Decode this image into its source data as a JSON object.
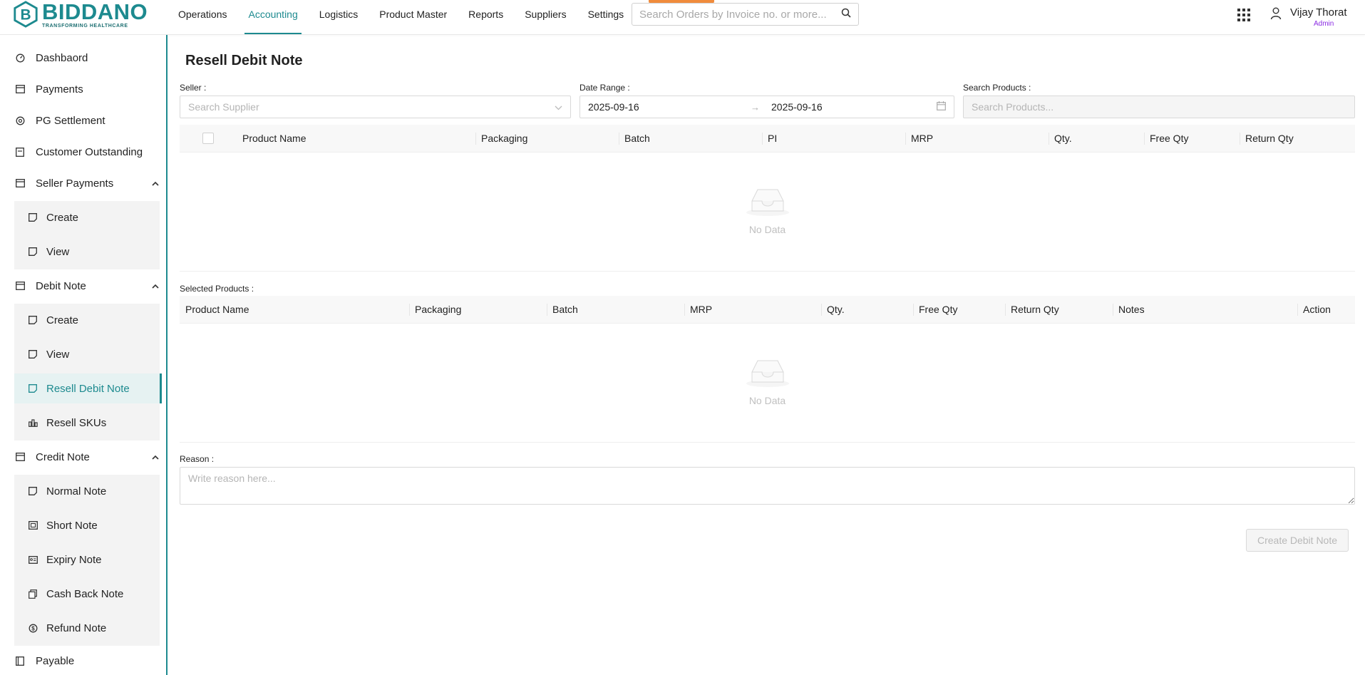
{
  "brand": {
    "name": "BIDDANO",
    "tagline": "TRANSFORMING HEALTHCARE",
    "color": "#1d8a8f"
  },
  "topnav": [
    {
      "label": "Operations",
      "active": false
    },
    {
      "label": "Accounting",
      "active": true
    },
    {
      "label": "Logistics",
      "active": false
    },
    {
      "label": "Product Master",
      "active": false
    },
    {
      "label": "Reports",
      "active": false
    },
    {
      "label": "Suppliers",
      "active": false
    },
    {
      "label": "Settings",
      "active": false
    }
  ],
  "header_search": {
    "placeholder": "Search Orders by Invoice no. or more..."
  },
  "user": {
    "name": "Vijay Thorat",
    "role": "Admin"
  },
  "sidebar": {
    "dashboard": "Dashbaord",
    "payments": "Payments",
    "pg_settlement": "PG Settlement",
    "customer_outstanding": "Customer Outstanding",
    "seller_payments": {
      "label": "Seller Payments",
      "create": "Create",
      "view": "View"
    },
    "debit_note": {
      "label": "Debit Note",
      "create": "Create",
      "view": "View",
      "resell_debit_note": "Resell Debit Note",
      "resell_skus": "Resell SKUs"
    },
    "credit_note": {
      "label": "Credit Note",
      "normal": "Normal Note",
      "short": "Short Note",
      "expiry": "Expiry Note",
      "cashback": "Cash Back Note",
      "refund": "Refund Note"
    },
    "payable": "Payable"
  },
  "page": {
    "title": "Resell Debit Note",
    "seller_label": "Seller :",
    "seller_placeholder": "Search Supplier",
    "date_label": "Date Range :",
    "date_from": "2025-09-16",
    "date_to": "2025-09-16",
    "date_separator": "→",
    "products_label": "Search Products :",
    "products_placeholder": "Search Products...",
    "products_table": {
      "columns": [
        "Product Name",
        "Packaging",
        "Batch",
        "PI",
        "MRP",
        "Qty.",
        "Free Qty",
        "Return Qty"
      ],
      "empty": "No Data"
    },
    "selected_label": "Selected Products :",
    "selected_table": {
      "columns": [
        "Product Name",
        "Packaging",
        "Batch",
        "MRP",
        "Qty.",
        "Free Qty",
        "Return Qty",
        "Notes",
        "Action"
      ],
      "empty": "No Data"
    },
    "reason_label": "Reason :",
    "reason_placeholder": "Write reason here...",
    "submit_label": "Create Debit Note"
  }
}
